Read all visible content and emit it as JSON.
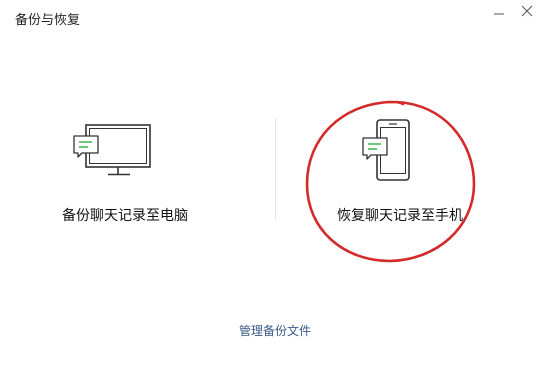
{
  "window": {
    "title": "备份与恢复"
  },
  "options": {
    "backup": {
      "label": "备份聊天记录至电脑",
      "icon": "monitor-chat-icon"
    },
    "restore": {
      "label": "恢复聊天记录至手机",
      "icon": "phone-chat-icon"
    }
  },
  "footer": {
    "manage_label": "管理备份文件"
  },
  "colors": {
    "accent_green": "#3db54a",
    "link_blue": "#3a5a8a",
    "annotation_red": "#d42a2a",
    "icon_stroke": "#333333"
  }
}
